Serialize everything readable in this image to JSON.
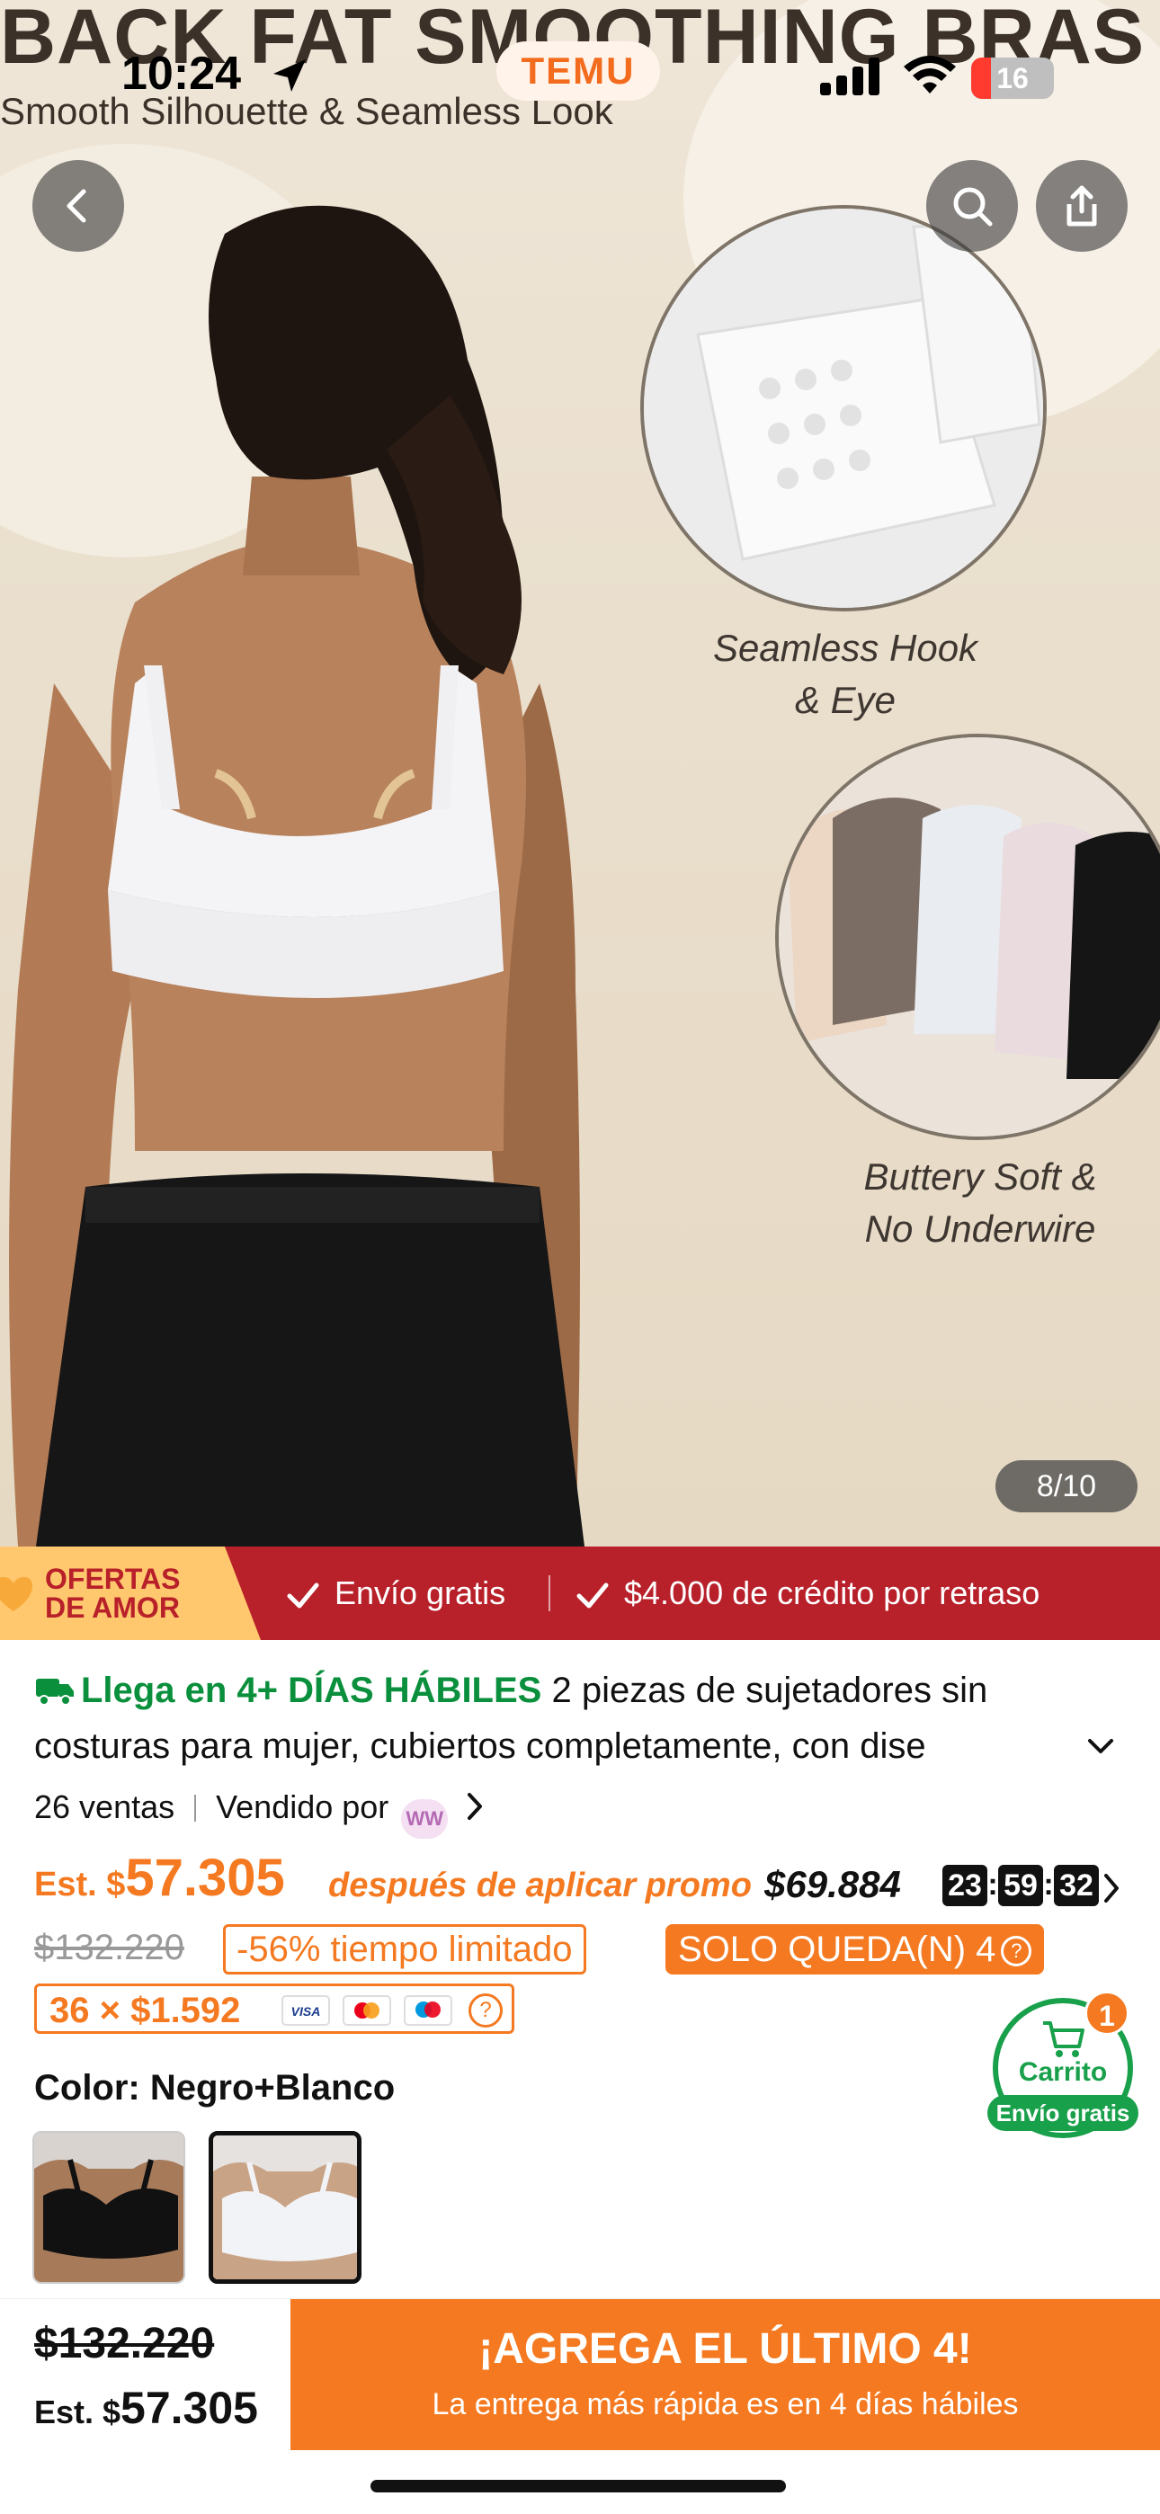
{
  "hero": {
    "banner_title": "BACK FAT SMOOTHING BRAS",
    "banner_subtitle": "Smooth Silhouette & Seamless Look",
    "callout_1_line1": "Seamless Hook",
    "callout_1_line2": "& Eye",
    "callout_2_line1": "Buttery Soft &",
    "callout_2_line2": "No Underwire",
    "image_counter": "8/10"
  },
  "status_bar": {
    "time": "10:24",
    "app_pill": "TEMU",
    "battery": "16"
  },
  "nav": {
    "back_icon": "chevron-left-icon",
    "search_icon": "search-icon",
    "share_icon": "share-icon"
  },
  "promo": {
    "tag_line1": "OFERTAS",
    "tag_line2": "DE AMOR",
    "item1": "Envío gratis",
    "item2": "$4.000 de crédito por retraso"
  },
  "product": {
    "arrival": "Llega en 4+ DÍAS HÁBILES",
    "title_part1": "2 piezas de sujetadores sin",
    "title_line2": "costuras para mujer, cubiertos completamente, con dise",
    "sales": "26 ventas",
    "sold_by": "Vendido por",
    "seller_badge": "WW",
    "est_label": "Est. $",
    "est_value": "57.305",
    "after_promo": "después de aplicar promo",
    "orig_price": "$69.884",
    "timer_h": "23",
    "timer_m": "59",
    "timer_s": "32",
    "strike_price": "$132.220",
    "discount": "-56% tiempo limitado",
    "stock": "SOLO QUEDA(N) 4",
    "installments": "36 × $1.592",
    "color_label": "Color: Negro+Blanco"
  },
  "cart": {
    "label": "Carrito",
    "free_shipping": "Envío gratis",
    "badge": "1"
  },
  "bottom": {
    "strike_price": "$132.220",
    "est_label": "Est. $",
    "est_value": "57.305",
    "cta_main": "¡AGREGA EL ÚLTIMO 4!",
    "cta_sub": "La entrega más rápida es en 4 días hábiles"
  },
  "colors": {
    "accent": "#f47920",
    "promo_red": "#b8202a",
    "success": "#19a04b",
    "arrival_green": "#0a8f3c"
  }
}
